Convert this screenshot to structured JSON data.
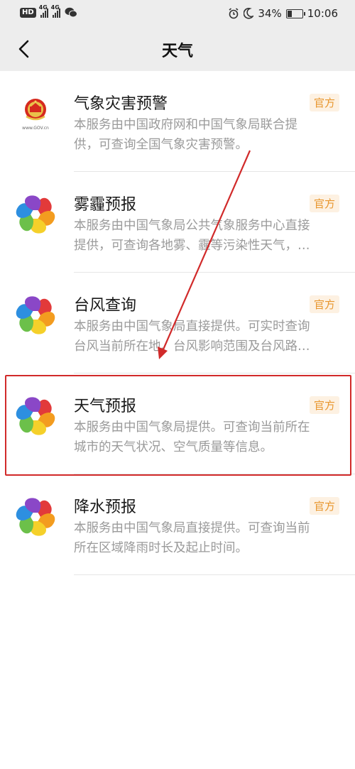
{
  "status_bar": {
    "hd_label": "HD",
    "network_1": "4G",
    "network_2": "4G",
    "battery_percent": "34%",
    "battery_level": 0.34,
    "time": "10:06"
  },
  "nav": {
    "title": "天气"
  },
  "items": [
    {
      "title": "气象灾害预警",
      "badge": "官方",
      "desc_line1": "本服务由中国政府网和中国气象局联合提",
      "desc_line2": "供，可查询全国气象灾害预警。",
      "logo": "gov-emblem-icon",
      "logo_text": "www.GOV.cn"
    },
    {
      "title": "雾霾预报",
      "badge": "官方",
      "desc_line1": "本服务由中国气象局公共气象服务中心直接",
      "desc_line2": "提供，可查询各地雾、霾等污染性天气，…",
      "logo": "weather-pinwheel-icon"
    },
    {
      "title": "台风查询",
      "badge": "官方",
      "desc_line1": "本服务由中国气象局直接提供。可实时查询",
      "desc_line2": "台风当前所在地、台风影响范围及台风路…",
      "logo": "weather-pinwheel-icon"
    },
    {
      "title": "天气预报",
      "badge": "官方",
      "desc_line1": "本服务由中国气象局提供。可查询当前所在",
      "desc_line2": "城市的天气状况、空气质量等信息。",
      "logo": "weather-pinwheel-icon"
    },
    {
      "title": "降水预报",
      "badge": "官方",
      "desc_line1": "本服务由中国气象局直接提供。可查询当前",
      "desc_line2": "所在区域降雨时长及起止时间。",
      "logo": "weather-pinwheel-icon"
    }
  ],
  "annotation": {
    "color": "#d12a2a"
  },
  "colors": {
    "badge_text": "#e8962e",
    "badge_bg": "#fdf1e2",
    "desc": "#9a9a9a"
  }
}
